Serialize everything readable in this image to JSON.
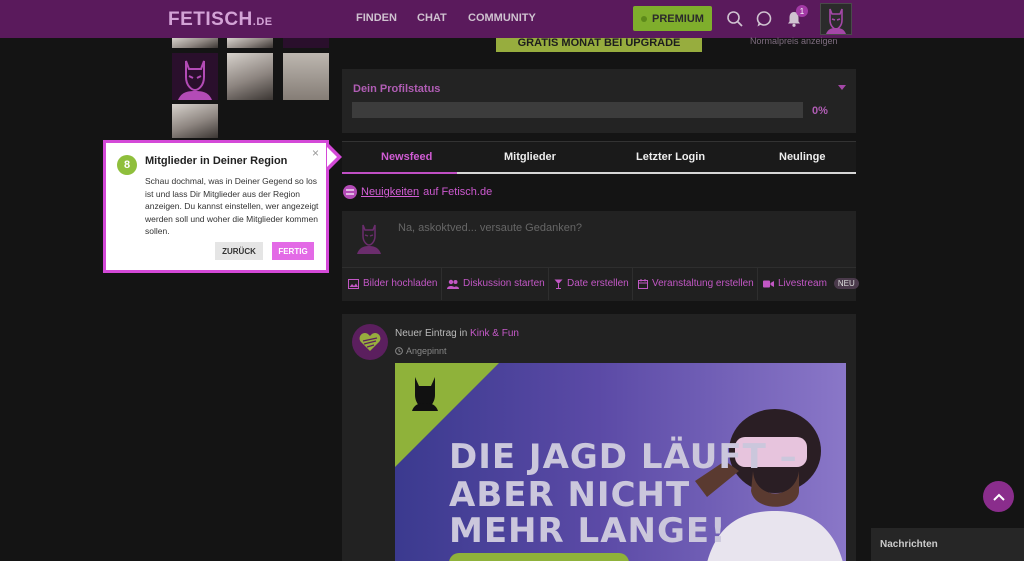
{
  "header": {
    "logo_main": "FETISCH",
    "logo_tld": ".DE",
    "nav": [
      "FINDEN",
      "CHAT",
      "COMMUNITY"
    ],
    "premium_label": "PREMIUM",
    "notification_count": "1"
  },
  "upgrade": {
    "button_label": "GRATIS MONAT BEI UPGRADE",
    "normal_price_link": "Normalpreis anzeigen"
  },
  "profile_status": {
    "title": "Dein Profilstatus",
    "progress": 0,
    "percent_label": "0%"
  },
  "tabs": [
    {
      "label": "Newsfeed",
      "active": true
    },
    {
      "label": "Mitglieder",
      "active": false
    },
    {
      "label": "Letzter Login",
      "active": false
    },
    {
      "label": "Neulinge",
      "active": false
    }
  ],
  "news_line": {
    "link": "Neuigkeiten",
    "suffix": "auf Fetisch.de"
  },
  "composer": {
    "placeholder": "Na, askoktved... versaute Gedanken?"
  },
  "actions": [
    {
      "label": "Bilder hochladen",
      "icon": "image-icon"
    },
    {
      "label": "Diskussion starten",
      "icon": "users-icon"
    },
    {
      "label": "Date erstellen",
      "icon": "glass-icon"
    },
    {
      "label": "Veranstaltung erstellen",
      "icon": "calendar-icon"
    },
    {
      "label": "Livestream",
      "icon": "video-icon",
      "badge": "NEU"
    }
  ],
  "post": {
    "prefix": "Neuer Eintrag in",
    "category": "Kink & Fun",
    "pinned_label": "Angepinnt",
    "banner_lines": [
      "DIE JAGD LÄUFT –",
      "ABER NICHT",
      "MEHR LANGE!"
    ]
  },
  "tooltip": {
    "step": "8",
    "title": "Mitglieder in Deiner Region",
    "body": "Schau dochmal, was in Deiner Gegend so los ist und lass Dir Mitglieder aus der Region anzeigen. Du kannst einstellen, wer angezeigt werden soll und woher die Mitglieder kommen sollen.",
    "back_label": "ZURÜCK",
    "done_label": "FERTIG",
    "close": "×"
  },
  "chat_panel": {
    "title": "Nachrichten"
  },
  "colors": {
    "brand_purple": "#5a1a5c",
    "accent_magenta": "#c04fc4",
    "premium_green": "#7fae2c"
  }
}
